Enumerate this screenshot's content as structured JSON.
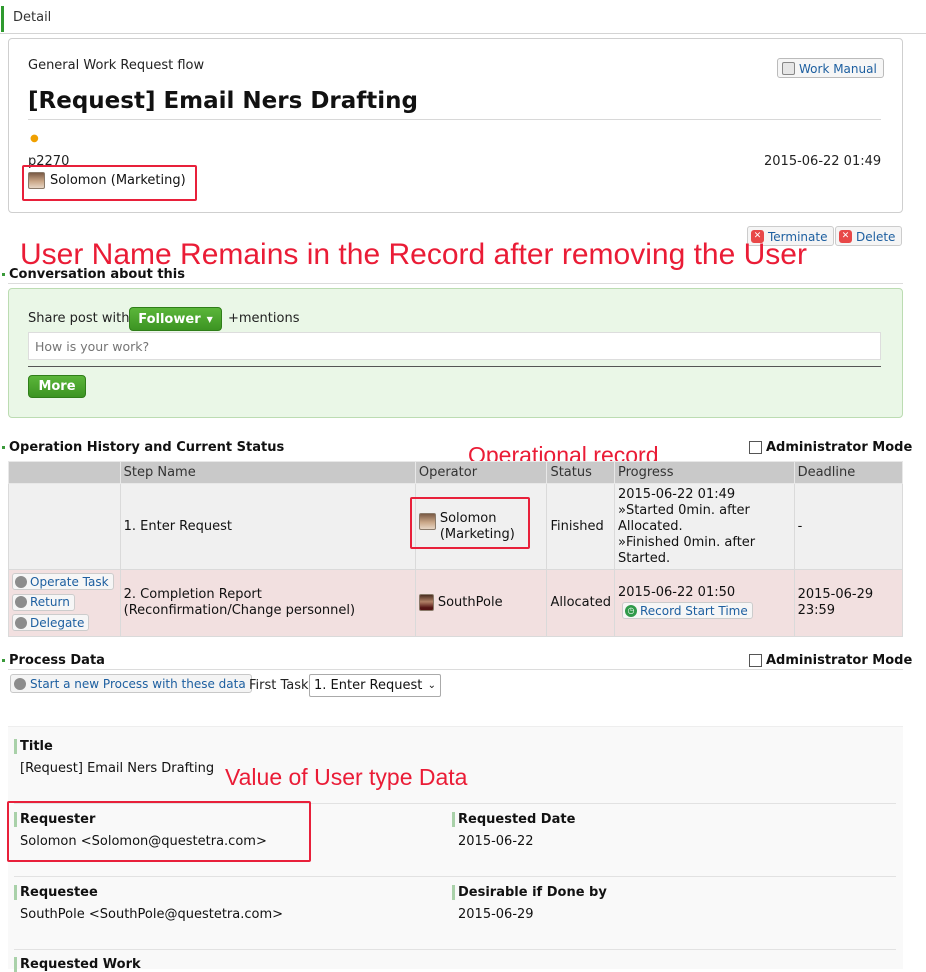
{
  "tab": {
    "label": "Detail"
  },
  "header": {
    "flow_name": "General Work Request flow",
    "title": "[Request] Email Ners Drafting",
    "process_id": "p2270",
    "created_at": "2015-06-22 01:49",
    "requester_chip": "Solomon (Marketing)",
    "work_manual_label": "Work Manual"
  },
  "actions": {
    "terminate_label": "Terminate",
    "delete_label": "Delete"
  },
  "annotations": {
    "top": "User Name Remains in the Record after removing the User",
    "operational": "Operational record",
    "user_type": "Value of User type Data"
  },
  "conversation": {
    "section_title": "Conversation about this",
    "share_label": "Share post with:",
    "follower_label": "Follower",
    "mentions_label": "+mentions",
    "input_placeholder": "How is your work?",
    "more_label": "More"
  },
  "history": {
    "section_title": "Operation History and Current Status",
    "admin_mode_label": "Administrator Mode",
    "columns": [
      "",
      "Step Name",
      "Operator",
      "Status",
      "Progress",
      "Deadline"
    ],
    "rows": [
      {
        "step": "1. Enter Request",
        "operator": "Solomon (Marketing)",
        "status": "Finished",
        "progress_time": "2015-06-22 01:49",
        "progress_line1": "»Started 0min. after Allocated.",
        "progress_line2": "»Finished 0min. after Started.",
        "deadline": "-"
      },
      {
        "step": "2. Completion Report (Reconfirmation/Change personnel)",
        "operator": "SouthPole",
        "status": "Allocated",
        "progress_time": "2015-06-22 01:50",
        "record_start_label": "Record Start Time",
        "deadline": "2015-06-29 23:59",
        "buttons": {
          "operate": "Operate Task",
          "return": "Return",
          "delegate": "Delegate"
        }
      }
    ]
  },
  "process_data": {
    "section_title": "Process Data",
    "admin_mode_label": "Administrator Mode",
    "start_new_label": "Start a new Process with these data",
    "first_task_label": "First Task",
    "first_task_selected": "1. Enter Request",
    "fields": {
      "title_label": "Title",
      "title_value": "[Request] Email Ners Drafting",
      "requester_label": "Requester",
      "requester_value": "Solomon <Solomon@questetra.com>",
      "requested_date_label": "Requested Date",
      "requested_date_value": "2015-06-22",
      "requestee_label": "Requestee",
      "requestee_value": "SouthPole <SouthPole@questetra.com>",
      "desirable_label": "Desirable if Done by",
      "desirable_value": "2015-06-29",
      "requested_work_label": "Requested Work"
    }
  },
  "colors": {
    "accent_green": "#3c9422",
    "annotation_red": "#ea1c36",
    "link_blue": "#1d5fa0"
  }
}
